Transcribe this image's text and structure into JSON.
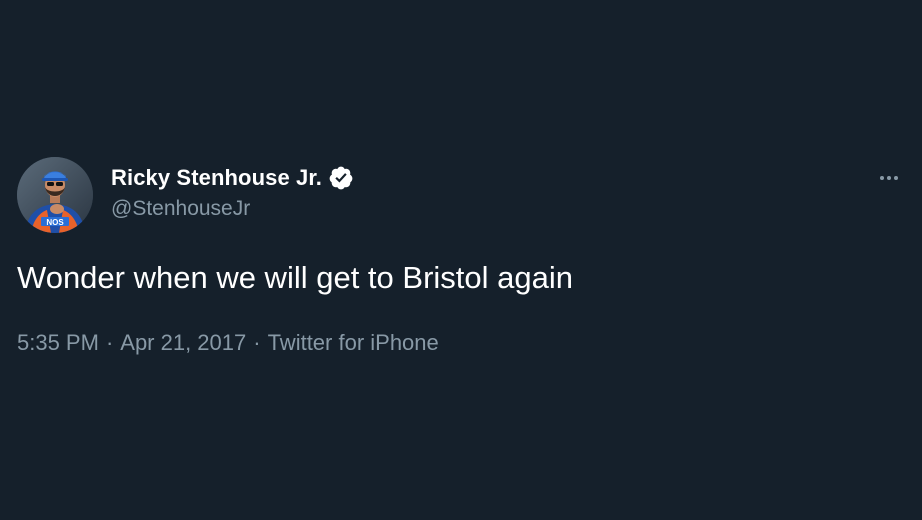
{
  "tweet": {
    "author": {
      "display_name": "Ricky Stenhouse Jr.",
      "handle": "@StenhouseJr",
      "verified": true,
      "avatar_icon": "racing-driver-avatar"
    },
    "text": "Wonder when we will get to Bristol again",
    "time": "5:35 PM",
    "separator": "·",
    "date": "Apr 21, 2017",
    "source": "Twitter for iPhone",
    "more_icon": "more-options-icon"
  },
  "colors": {
    "background": "#15202b",
    "primary_text": "#ffffff",
    "secondary_text": "#8899a6",
    "verified_badge": "#ffffff"
  }
}
